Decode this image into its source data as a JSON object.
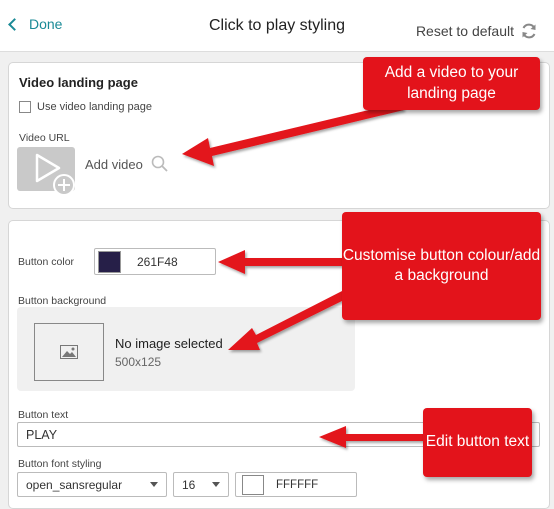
{
  "header": {
    "done_label": "Done",
    "title": "Click to play styling",
    "reset_label": "Reset to default"
  },
  "video_section": {
    "title": "Video landing page",
    "checkbox_label": "Use video landing page",
    "checked": false,
    "url_label": "Video URL",
    "add_video_label": "Add video"
  },
  "button_section": {
    "color_label": "Button color",
    "color_value": "261F48",
    "color_hex": "#261f48",
    "background_label": "Button background",
    "no_image_label": "No image selected",
    "image_dims": "500x125",
    "text_label": "Button text",
    "text_value": "PLAY",
    "font_styling_label": "Button font styling",
    "font_family_value": "open_sansregular",
    "font_size_value": "16",
    "font_color_value": "FFFFFF",
    "font_color_hex": "#ffffff"
  },
  "callouts": {
    "video": "Add a video to your landing page",
    "color": "Customise button colour/add a background",
    "text": "Edit button text"
  },
  "colors": {
    "accent": "#1a8a96",
    "callout_red": "#e3131b"
  }
}
